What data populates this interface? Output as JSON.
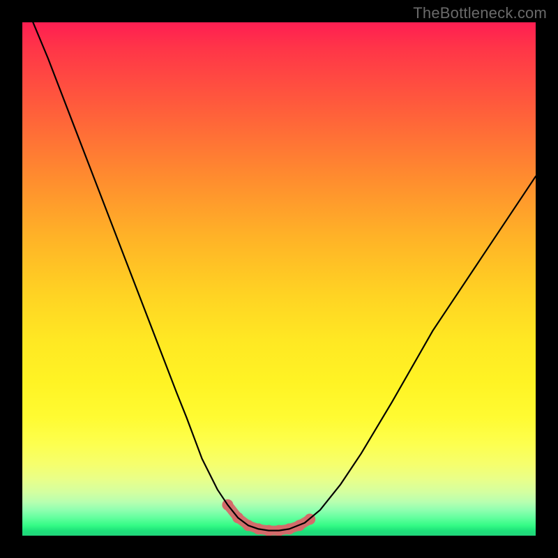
{
  "watermark": "TheBottleneck.com",
  "colors": {
    "frame_background": "#000000",
    "watermark_text": "#6a6a6a",
    "curve_stroke": "#000000",
    "valley_highlight": "#d46a6a",
    "gradient_top": "#ff1e52",
    "gradient_mid": "#ffe823",
    "gradient_bottom": "#21d47a"
  },
  "chart_data": {
    "type": "line",
    "title": "",
    "xlabel": "",
    "ylabel": "",
    "xlim": [
      0,
      100
    ],
    "ylim": [
      0,
      100
    ],
    "grid": false,
    "legend": false,
    "annotations": [],
    "series": [
      {
        "name": "curve",
        "x": [
          0,
          5,
          10,
          15,
          20,
          25,
          30,
          32,
          35,
          38,
          40,
          42,
          44,
          46,
          48,
          50,
          52,
          55,
          58,
          62,
          66,
          72,
          80,
          90,
          100
        ],
        "values": [
          105,
          93,
          80,
          67,
          54,
          41,
          28,
          23,
          15,
          9,
          6,
          3.5,
          2,
          1.3,
          1,
          1,
          1.3,
          2.5,
          5,
          10,
          16,
          26,
          40,
          55,
          70
        ]
      }
    ],
    "highlight_region": {
      "description": "valley floor highlighted segment",
      "x_range": [
        40,
        56
      ],
      "points_x": [
        40,
        42,
        44,
        46,
        48,
        50,
        52,
        54,
        56
      ],
      "points_y": [
        6,
        3.5,
        2,
        1.3,
        1,
        1,
        1.3,
        2,
        3.2
      ]
    }
  }
}
